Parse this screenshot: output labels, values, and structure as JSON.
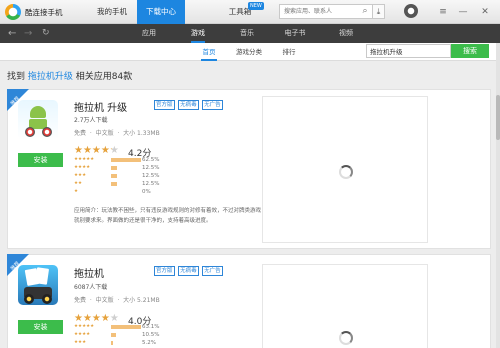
{
  "app": {
    "brand": "酷连接手机",
    "nav": {
      "my_phone": "我的手机",
      "download_center": "下载中心",
      "toolbox": "工具箱",
      "new_badge": "NEW"
    },
    "search": {
      "placeholder": "搜索应用、联系人"
    },
    "window": {
      "menu": "≡",
      "minimize": "—",
      "close": "✕"
    }
  },
  "categories": {
    "tabs": [
      "应用",
      "游戏",
      "音乐",
      "电子书",
      "视频"
    ],
    "active": "游戏"
  },
  "subtabs": {
    "tabs": [
      "首页",
      "游戏分类",
      "排行"
    ],
    "active": "首页",
    "search_value": "拖拉机升级",
    "search_button": "搜索"
  },
  "results": {
    "prefix": "找到",
    "keyword": "拖拉机升级",
    "suffix": "相关应用84款"
  },
  "apps": [
    {
      "ribbon": "推荐",
      "name": "拖拉机 升级",
      "tags": [
        "官方版",
        "无病毒",
        "无广告"
      ],
      "downloads": "2.7万人下载",
      "price": "免费",
      "lang": "中文版",
      "size": "大小 1.33MB",
      "rating_stars": 4.2,
      "score": "4.2分",
      "distribution": [
        {
          "stars": "★★★★★",
          "pct": "62.5%",
          "value": 62.5
        },
        {
          "stars": "★★★★",
          "pct": "12.5%",
          "value": 12.5
        },
        {
          "stars": "★★★",
          "pct": "12.5%",
          "value": 12.5
        },
        {
          "stars": "★★",
          "pct": "12.5%",
          "value": 12.5
        },
        {
          "stars": "★",
          "pct": "0%",
          "value": 0
        }
      ],
      "description": "应用简介：玩法教不困些，只有违反游戏规则的对修有着效，不过对牌类游戏就别要求来。界面做的还是很干净的，支持着高级进度。",
      "install": "安装"
    },
    {
      "ribbon": "推荐",
      "name": "拖拉机",
      "tags": [
        "官方版",
        "无病毒",
        "无广告"
      ],
      "downloads": "6087人下载",
      "price": "免费",
      "lang": "中文版",
      "size": "大小 5.21MB",
      "rating_stars": 4.0,
      "score": "4.0分",
      "distribution": [
        {
          "stars": "★★★★★",
          "pct": "63.1%",
          "value": 63.1
        },
        {
          "stars": "★★★★",
          "pct": "10.5%",
          "value": 10.5
        },
        {
          "stars": "★★★",
          "pct": "5.2%",
          "value": 5.2
        }
      ],
      "install": "安装"
    }
  ]
}
